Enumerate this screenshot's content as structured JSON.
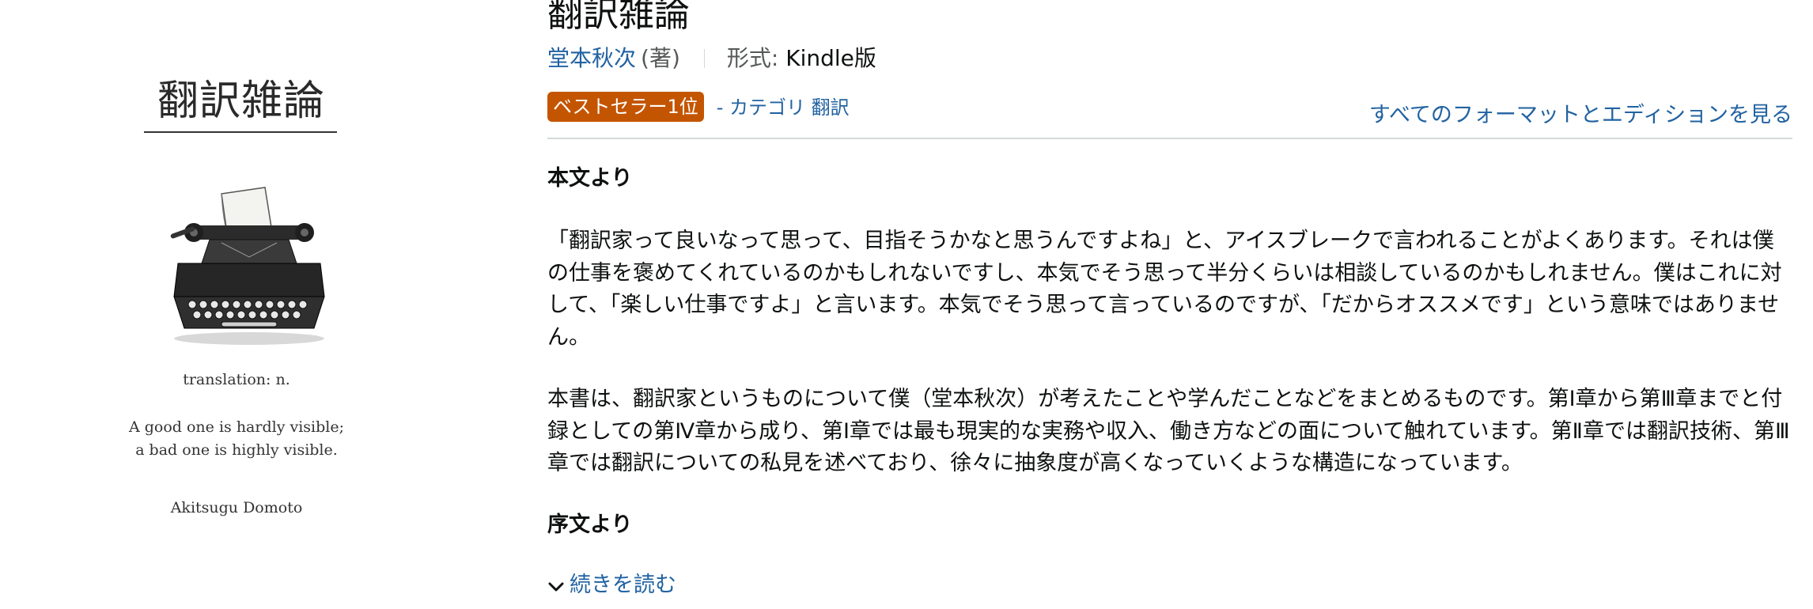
{
  "cover": {
    "title": "翻訳雑論",
    "definition": "translation: n.",
    "quote_line1": "A good one is hardly visible;",
    "quote_line2": "a bad one is highly visible.",
    "author": "Akitsugu Domoto",
    "image": "typewriter-illustration"
  },
  "product": {
    "title": "翻訳雑論",
    "author": "堂本秋次",
    "contribution": "(著)",
    "format_label": "形式:",
    "format_value": "Kindle版",
    "badge": "ベストセラー1位",
    "badge_category": "- カテゴリ 翻訳",
    "all_formats_link": "すべてのフォーマットとエディションを見る"
  },
  "description": {
    "heading_body": "本文より",
    "paragraph_1": "「翻訳家って良いなって思って、目指そうかなと思うんですよね」と、アイスブレークで言われることがよくあります。それは僕の仕事を褒めてくれているのかもしれないですし、本気でそう思って半分くらいは相談しているのかもしれません。僕はこれに対して、「楽しい仕事ですよ」と言います。本気でそう思って言っているのですが、「だからオススメです」という意味ではありません。",
    "paragraph_2": "本書は、翻訳家というものについて僕（堂本秋次）が考えたことや学んだことなどをまとめるものです。第Ⅰ章から第Ⅲ章までと付録としての第Ⅳ章から成り、第Ⅰ章では最も現実的な実務や収入、働き方などの面について触れています。第Ⅱ章では翻訳技術、第Ⅲ章では翻訳についての私見を述べており、徐々に抽象度が高くなっていくような構造になっています。",
    "heading_preface": "序文より",
    "read_more": "続きを読む",
    "read_more_icon": "chevron-down-icon"
  },
  "colors": {
    "link": "#2162a1",
    "badge": "#c45500",
    "text": "#0f1111",
    "muted": "#565959",
    "divider": "#d5d9d9"
  }
}
